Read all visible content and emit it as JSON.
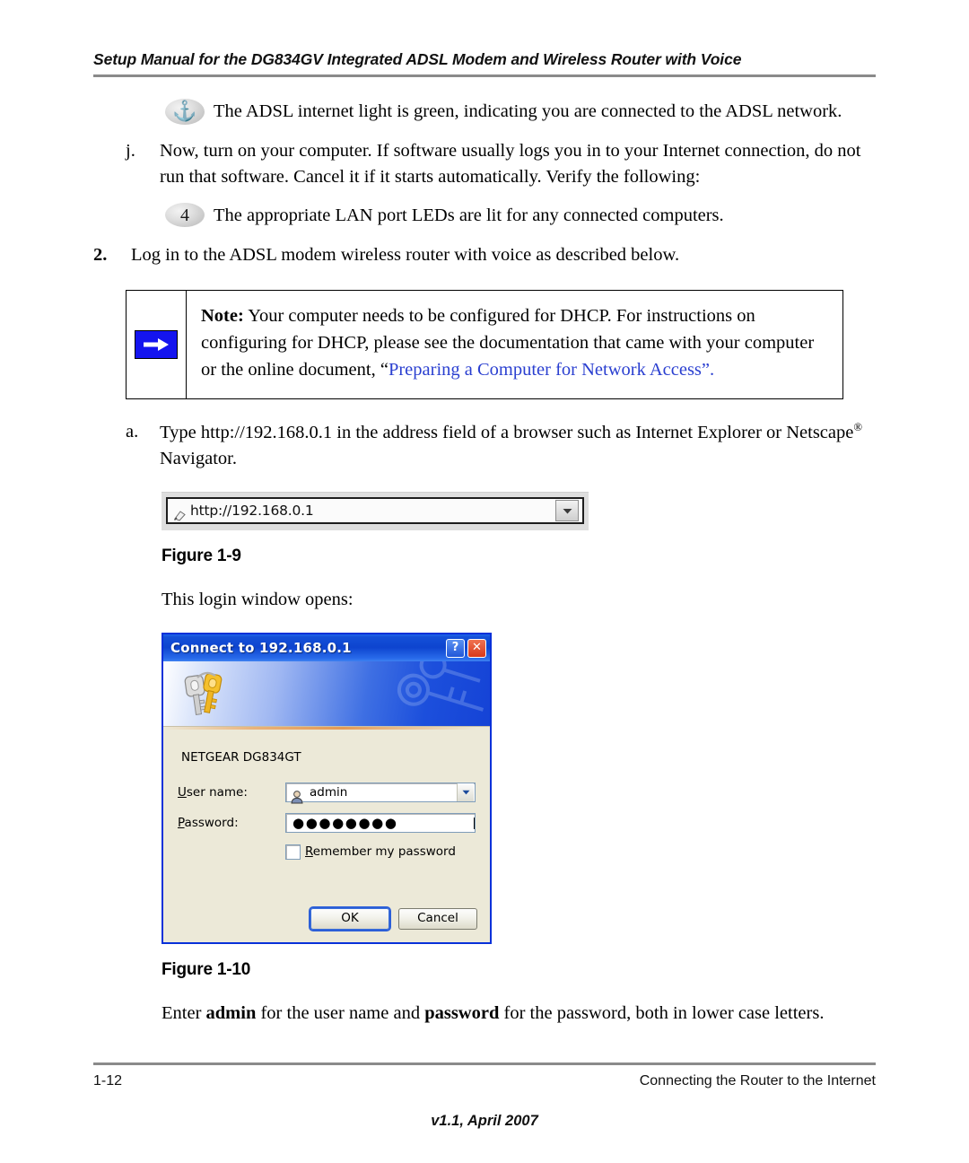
{
  "header": {
    "title": "Setup Manual for the DG834GV Integrated ADSL Modem and Wireless Router with Voice"
  },
  "content": {
    "adsl_light_bullet_glyph": "⚓",
    "adsl_light_text": "The ADSL internet light is green, indicating you are connected to the ADSL network.",
    "step_j": {
      "marker": "j.",
      "text": "Now, turn on your computer. If software usually logs you in to your Internet connection, do not run that software. Cancel it if it starts automatically. Verify the following:"
    },
    "lan_bullet_glyph": "4",
    "lan_bullet_text": "The appropriate LAN port LEDs are lit for any connected computers.",
    "step_2": {
      "marker": "2.",
      "text": "Log in to the ADSL modem wireless router with voice as described below."
    },
    "note": {
      "icon": "right-arrow-icon",
      "label": "Note:",
      "text_before_link": "Your computer needs to be configured for DHCP. For instructions on configuring for DHCP, please see the documentation that came with your computer or the online document, “",
      "link_text": "Preparing a Computer for Network Access",
      "text_after_link": "”.",
      "link_color": "#2a3fd0",
      "icon_color": "#1414ef"
    },
    "step_a": {
      "marker": "a.",
      "text_part1": "Type http://192.168.0.1 in the address field of a browser such as Internet Explorer or Netscape",
      "reg_symbol": "®",
      "text_part2": " Navigator."
    },
    "address_bar": {
      "icon": "page-shortcut-icon",
      "url": "http://192.168.0.1",
      "dropdown_icon": "chevron-down-icon"
    },
    "figure_1_9_caption": "Figure 1-9",
    "login_intro": "This login window opens:",
    "figure_1_10_caption": "Figure 1-10",
    "closing": {
      "part1": "Enter ",
      "bold1": "admin",
      "part2": " for the user name and ",
      "bold2": "password",
      "part3": " for the password, both in lower case letters."
    }
  },
  "dialog": {
    "title": "Connect to 192.168.0.1",
    "help_button_label": "?",
    "close_button_label": "✕",
    "banner_icon": "keys-icon",
    "banner_watermark_icon": "key-watermark-icon",
    "realm": "NETGEAR DG834GT",
    "username_label_prefix": "U",
    "username_label_rest": "ser name:",
    "username_value": "admin",
    "username_field_icon": "user-icon",
    "username_dropdown_icon": "chevron-down-icon",
    "password_label_prefix": "P",
    "password_label_rest": "assword:",
    "password_value": "●●●●●●●●",
    "remember_label_prefix": "R",
    "remember_label_rest": "emember my password",
    "remember_checked": false,
    "ok_label": "OK",
    "cancel_label": "Cancel",
    "titlebar_color": "#0d44cf",
    "body_color": "#ece9d8"
  },
  "footer": {
    "page_number": "1-12",
    "section": "Connecting the Router to the Internet",
    "version": "v1.1, April 2007"
  }
}
